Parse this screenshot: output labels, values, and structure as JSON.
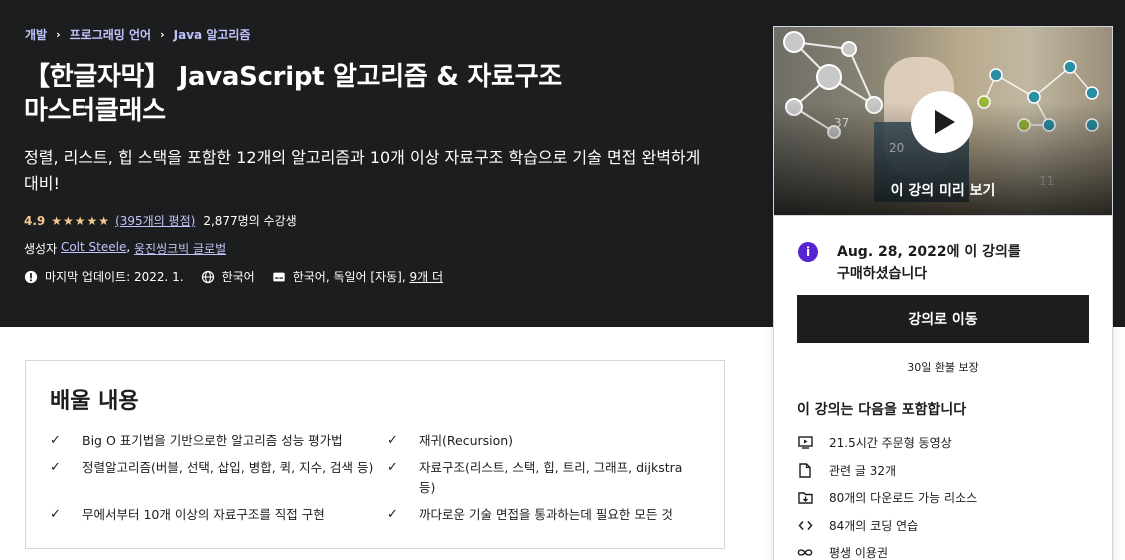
{
  "breadcrumb": [
    "개발",
    "프로그래밍 언어",
    "Java 알고리즘"
  ],
  "course": {
    "title_line1": "【한글자막】 JavaScript 알고리즘 & 자료구조",
    "title_line2": "마스터클래스",
    "subtitle": "정렬, 리스트, 힙 스택을 포함한 12개의 알고리즘과 10개 이상 자료구조 학습으로 기술 면접 완벽하게 대비!",
    "rating": "4.9",
    "stars": "★★★★★",
    "rating_count": "(395개의 평점)",
    "students": "2,877명의 수강생",
    "creator_label": "생성자",
    "creators": [
      "Colt Steele",
      "웅진씽크빅 글로벌"
    ],
    "last_updated": "마지막 업데이트: 2022. 1.",
    "language": "한국어",
    "captions": "한국어, 독일어 [자동],",
    "captions_more": "9개 더"
  },
  "sidebar": {
    "preview_label": "이 강의 미리 보기",
    "purchase_date": "Aug. 28, 2022",
    "purchase_text_1": "에 이 강의를",
    "purchase_text_2": "구매하셨습니다",
    "go_button": "강의로 이동",
    "refund": "30일 환불 보장",
    "includes_title": "이 강의는 다음을 포함합니다",
    "includes": [
      {
        "icon": "video-icon",
        "text": "21.5시간 주문형 동영상"
      },
      {
        "icon": "file-icon",
        "text": "관련 글 32개"
      },
      {
        "icon": "download-folder-icon",
        "text": "80개의 다운로드 가능 리소스"
      },
      {
        "icon": "code-icon",
        "text": "84개의 코딩 연습"
      },
      {
        "icon": "infinity-icon",
        "text": "평생 이용권"
      }
    ]
  },
  "learn": {
    "title": "배울 내용",
    "items": [
      "Big O 표기법을 기반으로한 알고리즘 성능 평가법",
      "재귀(Recursion)",
      "정렬알고리즘(버블, 선택, 삽입, 병합, 퀵, 지수, 검색 등)",
      "자료구조(리스트, 스택, 힙, 트리, 그래프, dijkstra 등)",
      "무에서부터 10개 이상의 자료구조를 직접 구현",
      "까다로운 기술 면접을 통과하는데 필요한 모든 것"
    ]
  },
  "colors": {
    "accent": "#c0c4fc",
    "star": "#f3ca8c",
    "dark": "#1c1d1f",
    "info": "#5624d0"
  }
}
